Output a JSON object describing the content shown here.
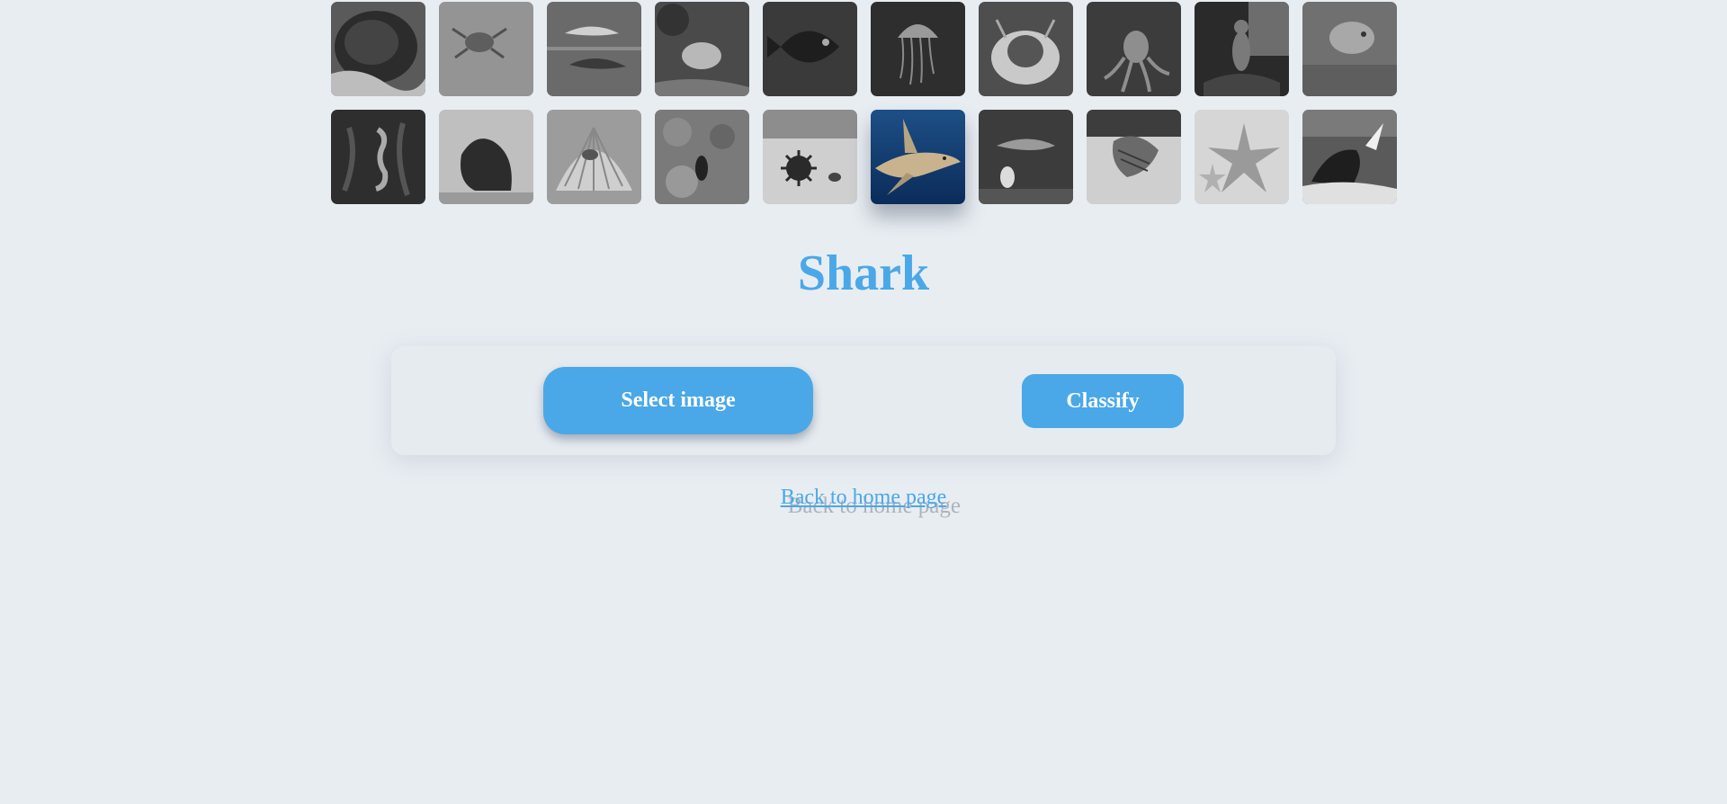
{
  "title": "Shark",
  "buttons": {
    "select_label": "Select image",
    "classify_label": "Classify"
  },
  "home_link": "Back to home page",
  "gallery": {
    "row1": [
      {
        "icon": "coral-icon"
      },
      {
        "icon": "crab-icon"
      },
      {
        "icon": "dolphin-icon"
      },
      {
        "icon": "eel-icon"
      },
      {
        "icon": "fish-icon"
      },
      {
        "icon": "jellyfish-icon"
      },
      {
        "icon": "lobster-icon"
      },
      {
        "icon": "octopus-icon"
      },
      {
        "icon": "otter-icon"
      },
      {
        "icon": "puffer-fish-icon"
      }
    ],
    "row2": [
      {
        "icon": "seahorse-icon"
      },
      {
        "icon": "seal-icon"
      },
      {
        "icon": "shell-icon"
      },
      {
        "icon": "turtle-icon"
      },
      {
        "icon": "sea-urchin-icon"
      },
      {
        "icon": "shark-icon",
        "selected": true
      },
      {
        "icon": "shrimp-icon"
      },
      {
        "icon": "squid-icon"
      },
      {
        "icon": "starfish-icon"
      },
      {
        "icon": "whale-icon"
      }
    ]
  },
  "colors": {
    "accent": "#4aa8e8",
    "background": "#e8edf2",
    "panel": "#e6ebf0"
  }
}
